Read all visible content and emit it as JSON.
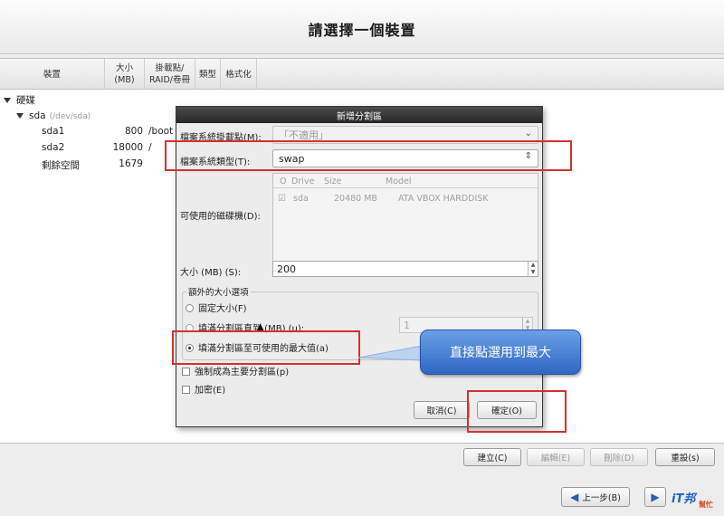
{
  "header": {
    "title": "請選擇一個裝置"
  },
  "tree": {
    "columns": [
      {
        "label": "裝置"
      },
      {
        "label": "大小\n(MB)"
      },
      {
        "label": "掛載點/\nRAID/卷冊"
      },
      {
        "label": "類型"
      },
      {
        "label": "格式化"
      }
    ],
    "root_label": "硬碟",
    "disk_label": "sda",
    "disk_path": "(/dev/sda)",
    "rows": [
      {
        "name": "sda1",
        "size": "800",
        "mount": "/boot"
      },
      {
        "name": "sda2",
        "size": "18000",
        "mount": "/"
      },
      {
        "name": "剩餘空間",
        "size": "1679",
        "mount": ""
      }
    ]
  },
  "dialog": {
    "title": "新增分割區",
    "mount_label": "檔案系統掛載點(M):",
    "mount_value": "「不適用」",
    "fstype_label": "檔案系統類型(T):",
    "fstype_value": "swap",
    "drives_label": "可使用的磁碟機(D):",
    "drive_columns": {
      "check": "O",
      "drive": "Drive",
      "size": "Size",
      "model": "Model"
    },
    "drive_row": {
      "drive": "sda",
      "size": "20480 MB",
      "model": "ATA VBOX HARDDISK"
    },
    "size_label": "大小 (MB) (S):",
    "size_value": "200",
    "extra_title": "額外的大小選項",
    "opt_fixed": "固定大小(F)",
    "opt_upto": "填滿分割區直到 (MB) (u):",
    "opt_upto_value": "1",
    "opt_max": "填滿分割區至可使用的最大值(a)",
    "force_primary": "強制成為主要分割區(p)",
    "encrypt": "加密(E)",
    "cancel": "取消(C)",
    "ok": "確定(O)"
  },
  "bottom": {
    "create": "建立(C)",
    "edit": "編輯(E)",
    "delete": "刪除(D)",
    "reset": "重設(s)",
    "back": "上一步(B)"
  },
  "annotation": {
    "callout_text": "直接點選用到最大",
    "color": "#d63030"
  },
  "watermark": {
    "text": "iT邦",
    "sub": "幫忙"
  }
}
